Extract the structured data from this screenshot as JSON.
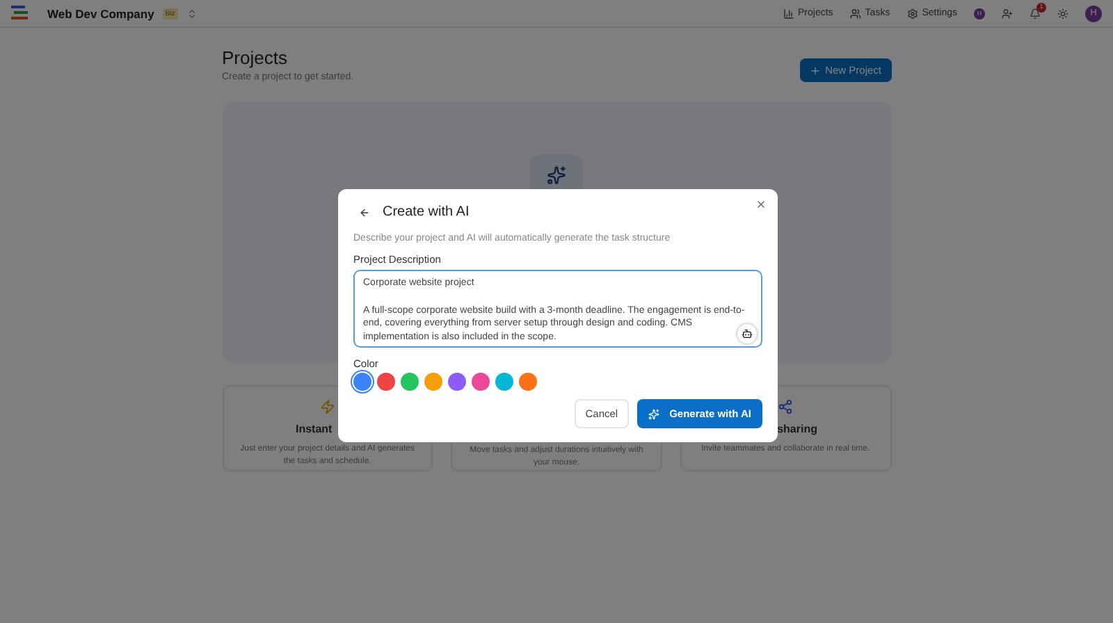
{
  "header": {
    "workspace": "Web Dev Company",
    "badge": "Biz",
    "nav": [
      {
        "label": "Projects"
      },
      {
        "label": "Tasks"
      },
      {
        "label": "Settings"
      }
    ],
    "member_initial": "H",
    "notification_count": "1",
    "avatar_initial": "H"
  },
  "page": {
    "title": "Projects",
    "subtitle": "Create a project to get started.",
    "new_button": "New Project"
  },
  "features": [
    {
      "title": "Instant",
      "text": "Just enter your project details and AI generates the tasks and schedule."
    },
    {
      "text": "Move tasks and adjust durations intuitively with your mouse."
    },
    {
      "title": "sharing",
      "text": "Invite teammates and collaborate in real time."
    }
  ],
  "dialog": {
    "title": "Create with AI",
    "description": "Describe your project and AI will automatically generate the task structure",
    "field_label": "Project Description",
    "value": "Corporate website project\n\nA full-scope corporate website build with a 3-month deadline. The engagement is end-to-end, covering everything from server setup through design and coding. CMS implementation is also included in the scope.",
    "color_label": "Color",
    "colors": [
      {
        "color": "#3b82f6",
        "selected": true
      },
      {
        "color": "#ef4444",
        "selected": false
      },
      {
        "color": "#22c55e",
        "selected": false
      },
      {
        "color": "#f59e0b",
        "selected": false
      },
      {
        "color": "#8b5cf6",
        "selected": false
      },
      {
        "color": "#ec4899",
        "selected": false
      },
      {
        "color": "#06b6d4",
        "selected": false
      },
      {
        "color": "#f97316",
        "selected": false
      }
    ],
    "cancel": "Cancel",
    "generate": "Generate with AI"
  }
}
